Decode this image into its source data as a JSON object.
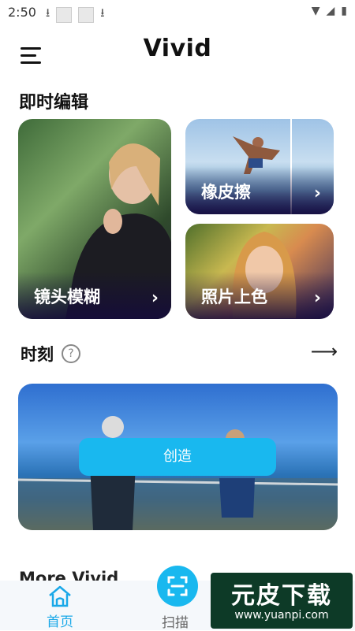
{
  "status_bar": {
    "time": "2:50"
  },
  "header": {
    "title": "Vivid"
  },
  "instant_edit": {
    "title": "即时编辑",
    "cards": [
      {
        "label": "镜头模糊"
      },
      {
        "label": "橡皮擦"
      },
      {
        "label": "照片上色"
      }
    ]
  },
  "moments": {
    "title": "时刻",
    "create_label": "创造"
  },
  "more": {
    "title": "More Vivid"
  },
  "bottom_nav": {
    "home_label": "首页",
    "scan_label": "扫描"
  },
  "watermark": {
    "main": "元皮下载",
    "url": "www.yuanpi.com"
  },
  "colors": {
    "accent": "#19b8ef",
    "text": "#111111",
    "nav_bg": "#f5f8fb"
  }
}
